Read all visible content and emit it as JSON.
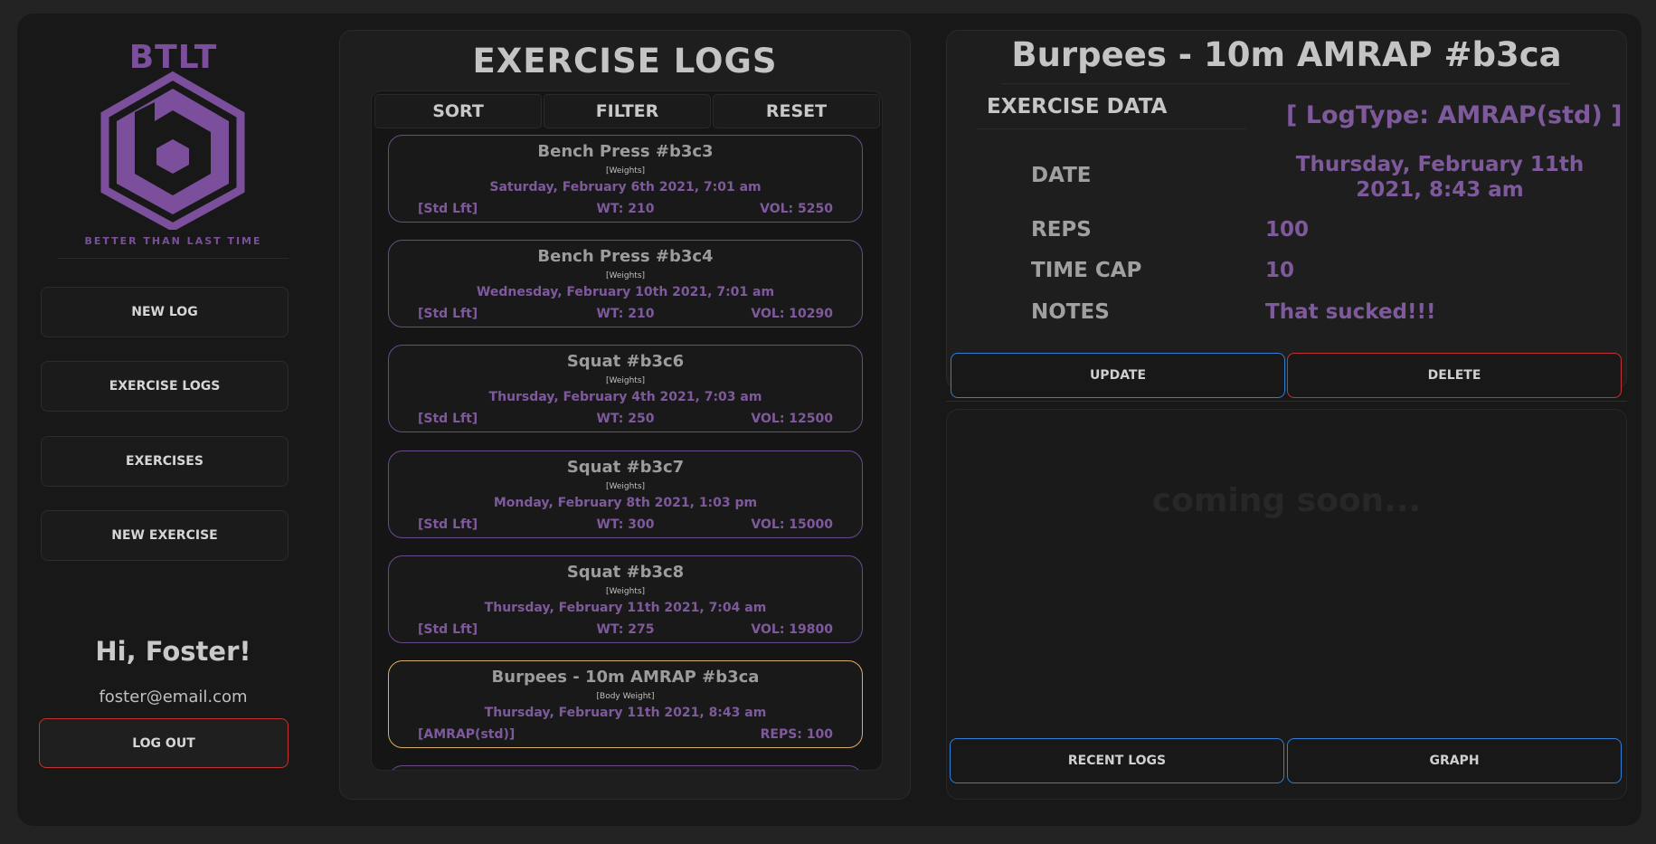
{
  "brand": {
    "title": "BTLT",
    "tagline": "BETTER THAN LAST TIME",
    "color": "#7b4f9b"
  },
  "nav": [
    {
      "label": "NEW LOG"
    },
    {
      "label": "EXERCISE LOGS"
    },
    {
      "label": "EXERCISES"
    },
    {
      "label": "NEW EXERCISE"
    }
  ],
  "user": {
    "greeting": "Hi, Foster!",
    "email": "foster@email.com",
    "logout_label": "LOG OUT"
  },
  "logs": {
    "title": "EXERCISE LOGS",
    "controls": {
      "sort": "SORT",
      "filter": "FILTER",
      "reset": "RESET"
    },
    "items": [
      {
        "title": "Bench Press #b3c3",
        "category": "[Weights]",
        "date": "Saturday, February 6th 2021, 7:01 am",
        "logtype": "[Std Lft]",
        "weight": "WT: 210",
        "metric": "VOL: 5250",
        "selected": false
      },
      {
        "title": "Bench Press #b3c4",
        "category": "[Weights]",
        "date": "Wednesday, February 10th 2021, 7:01 am",
        "logtype": "[Std Lft]",
        "weight": "WT: 210",
        "metric": "VOL: 10290",
        "selected": false
      },
      {
        "title": "Squat #b3c6",
        "category": "[Weights]",
        "date": "Thursday, February 4th 2021, 7:03 am",
        "logtype": "[Std Lft]",
        "weight": "WT: 250",
        "metric": "VOL: 12500",
        "selected": false
      },
      {
        "title": "Squat #b3c7",
        "category": "[Weights]",
        "date": "Monday, February 8th 2021, 1:03 pm",
        "logtype": "[Std Lft]",
        "weight": "WT: 300",
        "metric": "VOL: 15000",
        "selected": false
      },
      {
        "title": "Squat #b3c8",
        "category": "[Weights]",
        "date": "Thursday, February 11th 2021, 7:04 am",
        "logtype": "[Std Lft]",
        "weight": "WT: 275",
        "metric": "VOL: 19800",
        "selected": false
      },
      {
        "title": "Burpees - 10m AMRAP #b3ca",
        "category": "[Body Weight]",
        "date": "Thursday, February 11th 2021, 8:43 am",
        "logtype": "[AMRAP(std)]",
        "weight": "",
        "metric": "REPS: 100",
        "selected": true
      }
    ]
  },
  "detail": {
    "title": "Burpees - 10m AMRAP #b3ca",
    "section_label": "EXERCISE DATA",
    "logtype": "[ LogType: AMRAP(std) ]",
    "fields": {
      "date_label": "DATE",
      "date_value": "Thursday, February 11th 2021, 8:43 am",
      "reps_label": "REPS",
      "reps_value": "100",
      "timecap_label": "TIME CAP",
      "timecap_value": "10",
      "notes_label": "NOTES",
      "notes_value": "That sucked!!!"
    },
    "update_label": "UPDATE",
    "delete_label": "DELETE"
  },
  "graph": {
    "placeholder": "coming soon...",
    "recent_label": "RECENT LOGS",
    "graph_label": "GRAPH"
  },
  "colors": {
    "accent_purple": "#7e5a9c",
    "update_border": "#2f7fd6",
    "delete_border": "#c03434",
    "selected_border": "#d8b06a"
  }
}
